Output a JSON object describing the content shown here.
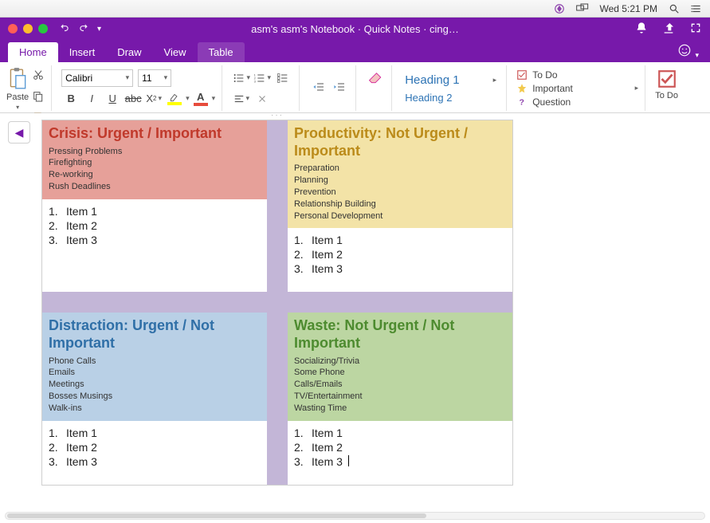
{
  "menubar": {
    "clock": "Wed 5:21 PM"
  },
  "window": {
    "title": "asm's asm's Notebook · Quick Notes · cing…"
  },
  "tabs": [
    "Home",
    "Insert",
    "Draw",
    "View",
    "Table"
  ],
  "active_tab": "Home",
  "highlight_tab": "Table",
  "ribbon": {
    "paste_label": "Paste",
    "font_name": "Calibri",
    "font_size": "11",
    "styles": {
      "h1": "Heading 1",
      "h2": "Heading 2"
    },
    "tags": {
      "todo": "To Do",
      "important": "Important",
      "question": "Question"
    },
    "todo_big": "To Do"
  },
  "matrix": {
    "quadrants": [
      {
        "id": "q1",
        "title": "Crisis: Urgent / Important",
        "subs": [
          "Pressing Problems",
          "Firefighting",
          "Re-working",
          "Rush Deadlines"
        ],
        "items": [
          "Item 1",
          "Item 2",
          "Item 3"
        ]
      },
      {
        "id": "q2",
        "title": "Productivity: Not Urgent / Important",
        "subs": [
          "Preparation",
          "Planning",
          "Prevention",
          "Relationship Building",
          "Personal Development"
        ],
        "items": [
          "Item 1",
          "Item 2",
          "Item 3"
        ]
      },
      {
        "id": "q3",
        "title": "Distraction: Urgent / Not Important",
        "subs": [
          "Phone Calls",
          "Emails",
          "Meetings",
          "Bosses Musings",
          "Walk-ins"
        ],
        "items": [
          "Item 1",
          "Item 2",
          "Item 3"
        ]
      },
      {
        "id": "q4",
        "title": "Waste: Not Urgent / Not Important",
        "subs": [
          "Socializing/Trivia",
          "Some Phone",
          "Calls/Emails",
          "TV/Entertainment",
          "Wasting Time"
        ],
        "items": [
          "Item 1",
          "Item 2",
          "Item 3"
        ]
      }
    ]
  }
}
